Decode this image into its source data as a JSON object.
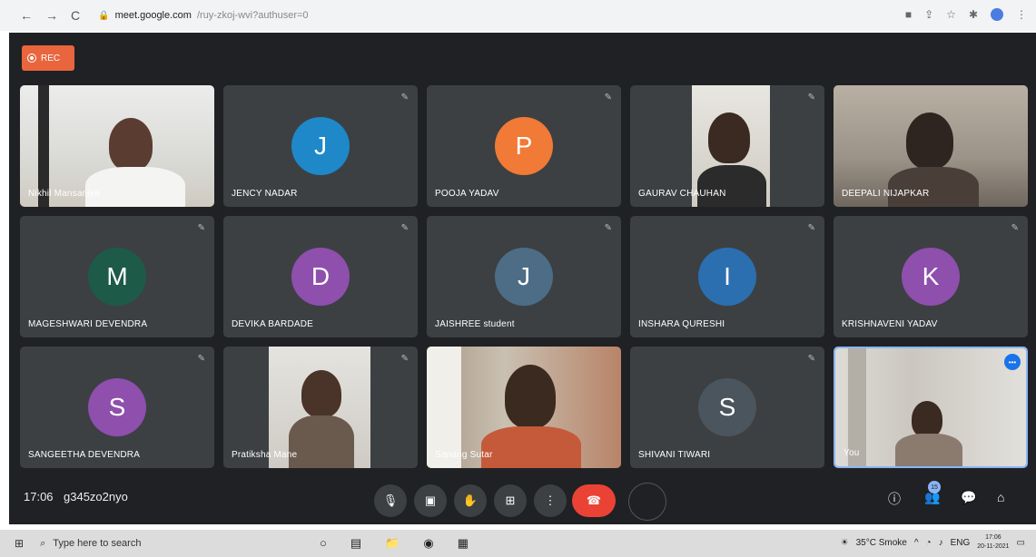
{
  "browser": {
    "back": "←",
    "forward": "→",
    "reload": "C",
    "host": "meet.google.com",
    "path": "/ruy-zkoj-wvi?authuser=0"
  },
  "rec_label": "REC",
  "colors": {
    "bg": "#202124",
    "tile": "#3c4043",
    "accent": "#e8653e",
    "end_call": "#ea4335"
  },
  "tiles": [
    {
      "name": "Nikhil Mansaniya",
      "type": "video"
    },
    {
      "name": "JENCY NADAR",
      "type": "avatar",
      "initial": "J",
      "color": "#1e88c8"
    },
    {
      "name": "POOJA YADAV",
      "type": "avatar",
      "initial": "P",
      "color": "#f07a36"
    },
    {
      "name": "GAURAV CHAUHAN",
      "type": "video"
    },
    {
      "name": "DEEPALI NIJAPKAR",
      "type": "video"
    },
    {
      "name": "MAGESHWARI DEVENDRA",
      "type": "avatar",
      "initial": "M",
      "color": "#1d5a48"
    },
    {
      "name": "DEVIKA BARDADE",
      "type": "avatar",
      "initial": "D",
      "color": "#8e4fad"
    },
    {
      "name": "JAISHREE student",
      "type": "avatar",
      "initial": "J",
      "color": "#4d6d86"
    },
    {
      "name": "INSHARA QURESHI",
      "type": "avatar",
      "initial": "I",
      "color": "#2c6fb0"
    },
    {
      "name": "KRISHNAVENI YADAV",
      "type": "avatar",
      "initial": "K",
      "color": "#8e4fad"
    },
    {
      "name": "SANGEETHA DEVENDRA",
      "type": "avatar",
      "initial": "S",
      "color": "#8e4fad"
    },
    {
      "name": "Pratiksha Mane",
      "type": "video"
    },
    {
      "name": "Sanang Sutar",
      "type": "video"
    },
    {
      "name": "SHIVANI TIWARI",
      "type": "avatar",
      "initial": "S",
      "color": "#4b555e"
    },
    {
      "name": "You",
      "type": "video"
    }
  ],
  "meeting": {
    "time": "17:06",
    "code": "g345zo2nyo",
    "participants": "15"
  },
  "taskbar": {
    "search_placeholder": "Type here to search",
    "weather": "35°C Smoke",
    "lang": "ENG",
    "clock_time": "17:06",
    "clock_date": "20-11-2021"
  }
}
